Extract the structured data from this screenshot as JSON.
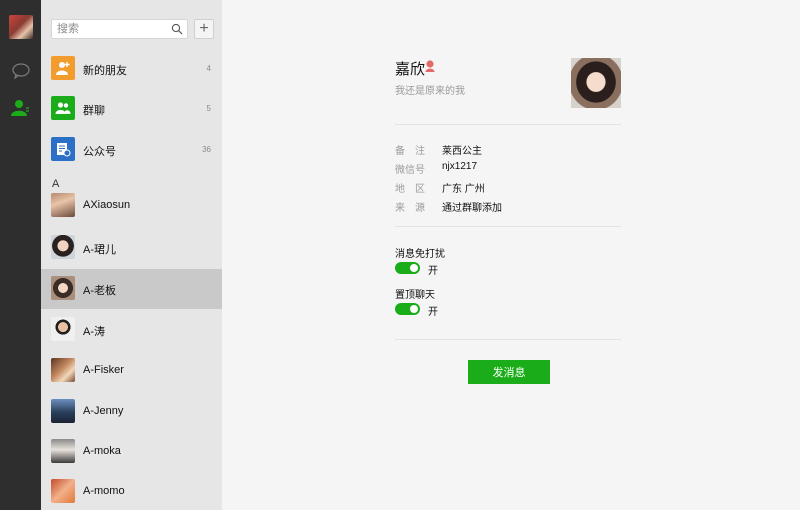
{
  "search": {
    "placeholder": "搜索"
  },
  "add_button": {
    "label": "+"
  },
  "special_entries": [
    {
      "label": "新的朋友",
      "count": "4",
      "icon": "new-friend-icon",
      "color": "#f39c2e"
    },
    {
      "label": "群聊",
      "count": "5",
      "icon": "group-chat-icon",
      "color": "#1aad19"
    },
    {
      "label": "公众号",
      "count": "36",
      "icon": "official-account-icon",
      "color": "#2b6fc7"
    }
  ],
  "section_letter": "A",
  "contacts": [
    {
      "name": "AXiaosun"
    },
    {
      "name": "A-珺儿"
    },
    {
      "name": "A-老板",
      "selected": true
    },
    {
      "name": "A-涛"
    },
    {
      "name": "A-Fisker"
    },
    {
      "name": "A-Jenny"
    },
    {
      "name": "A-moka"
    },
    {
      "name": "A-momo"
    }
  ],
  "profile": {
    "name": "嘉欣",
    "signature": "我还是原来的我",
    "gender_icon": "female-icon",
    "info": [
      {
        "label": "备　注",
        "value": "莱西公主"
      },
      {
        "label": "微信号",
        "value": "njx1217"
      },
      {
        "label": "地　区",
        "value": "广东 广州"
      },
      {
        "label": "来　源",
        "value": "通过群聊添加"
      }
    ],
    "settings": [
      {
        "label": "消息免打扰",
        "state": "开",
        "on": true
      },
      {
        "label": "置顶聊天",
        "state": "开",
        "on": true
      }
    ],
    "send_button": "发消息"
  },
  "colors": {
    "accent": "#1aad19",
    "rail": "#2e2e2e",
    "list_bg": "#e6e6e6",
    "selected_row": "#c9c9c9"
  }
}
